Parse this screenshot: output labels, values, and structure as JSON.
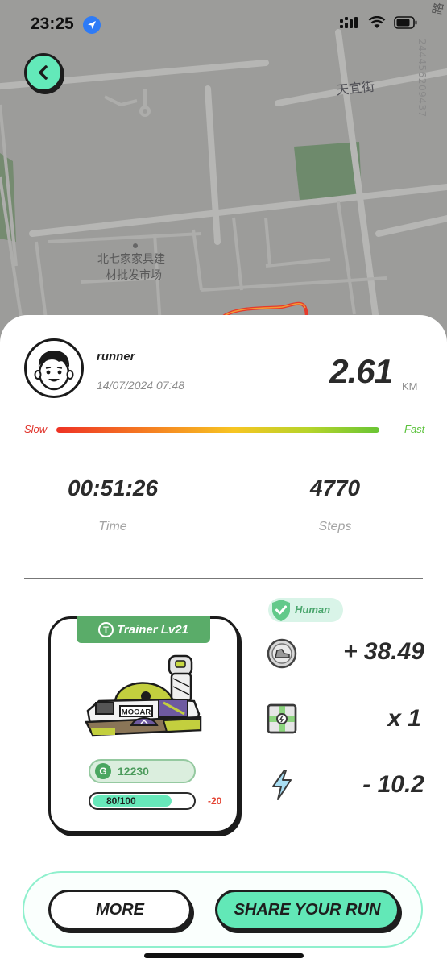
{
  "status_bar": {
    "time": "23:25"
  },
  "map": {
    "poi_line1": "北七家家具建",
    "poi_line2": "材批发市场",
    "street": "天宜街",
    "map_id": "2444562094​37",
    "corner_char": "路",
    "route_color": "#e53b2c"
  },
  "run": {
    "username": "runner",
    "datetime": "14/07/2024 07:48",
    "distance": "2.61",
    "distance_unit": "KM",
    "speed_slow_label": "Slow",
    "speed_fast_label": "Fast",
    "time_value": "00:51:26",
    "time_label": "Time",
    "steps_value": "4770",
    "steps_label": "Steps"
  },
  "sneaker": {
    "trainer_icon": "T",
    "trainer_label": "Trainer Lv21",
    "brand": "MOOAR",
    "gem_icon": "G",
    "gem_value": "12230",
    "durability_text": "80/100",
    "durability_fraction": 0.8,
    "durability_change": "-20"
  },
  "verification": {
    "label": "Human"
  },
  "rewards": {
    "gst": "+ 38.49",
    "box": "x 1",
    "energy": "- 10.2"
  },
  "actions": {
    "more": "MORE",
    "share": "SHARE YOUR RUN"
  },
  "colors": {
    "accent": "#62e8b7",
    "trainer_green": "#5aac69",
    "slow_red": "#e0332b",
    "fast_green": "#5bc23c"
  }
}
